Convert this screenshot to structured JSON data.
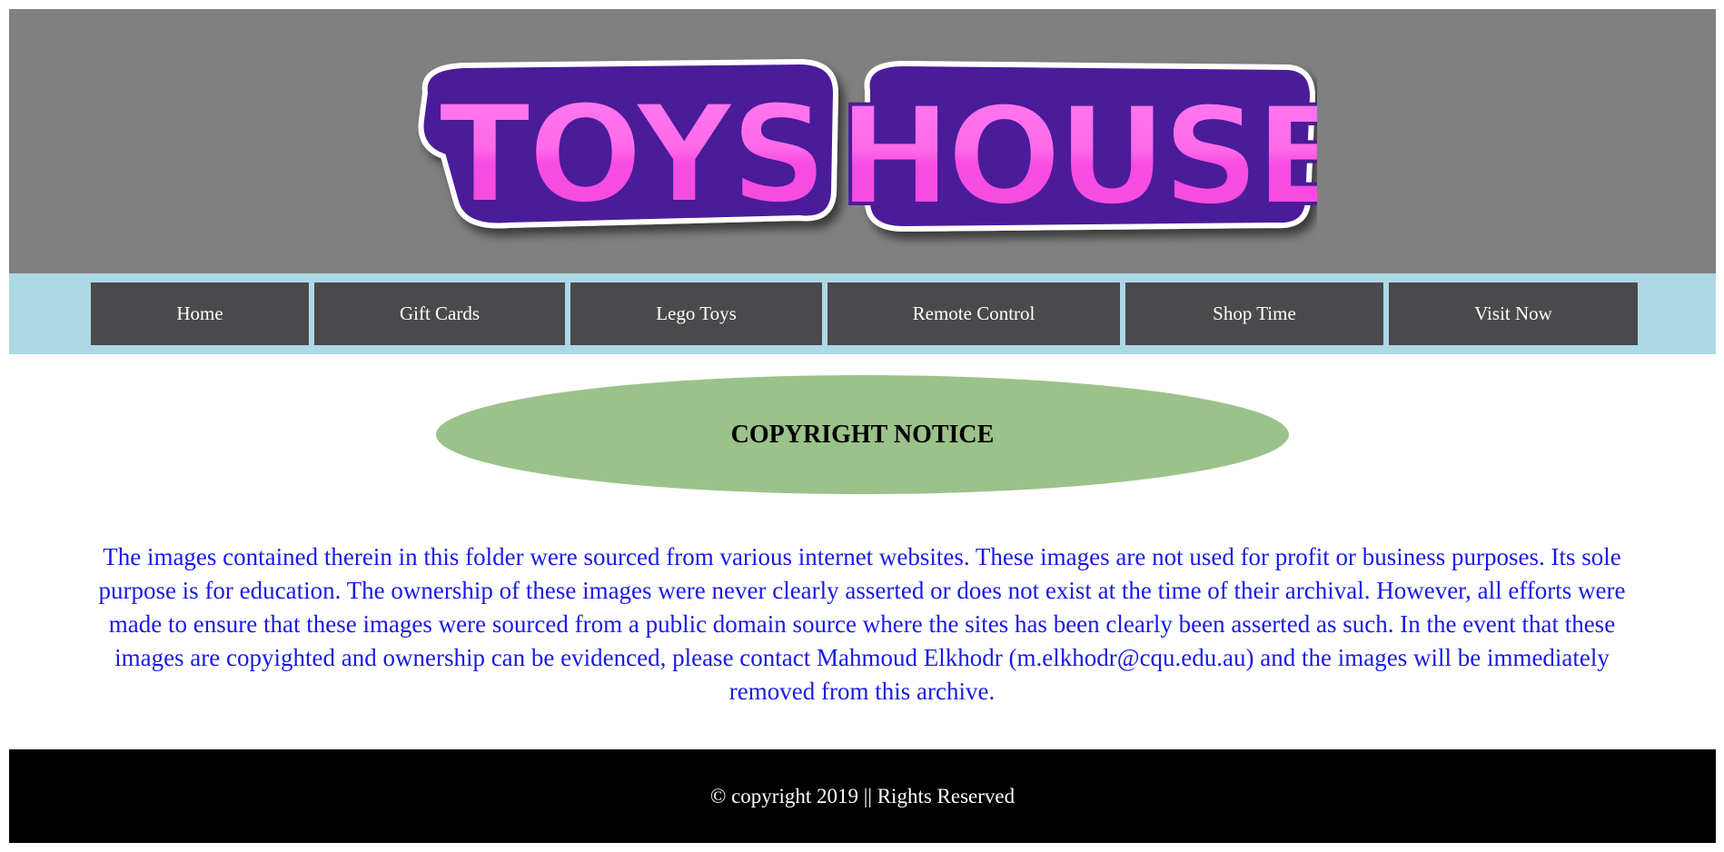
{
  "header": {
    "logo_text": "TOYS HOUSE",
    "background": "#808080"
  },
  "nav": {
    "background": "#add8e6",
    "button_color": "#4a494b",
    "items": [
      {
        "label": "Home"
      },
      {
        "label": "Gift Cards"
      },
      {
        "label": "Lego Toys"
      },
      {
        "label": "Remote Control"
      },
      {
        "label": "Shop Time"
      },
      {
        "label": "Visit Now"
      }
    ]
  },
  "notice": {
    "title": "COPYRIGHT NOTICE",
    "ellipse_color": "#9bc28a",
    "body": "The images contained therein in this folder were sourced from various internet websites. These images are not used for profit or business purposes. Its sole purpose is for education. The ownership of these images were never clearly asserted or does not exist at the time of their archival. However, all efforts were made to ensure that these images were sourced from a public domain source where the sites has been clearly been asserted as such. In the event that these images are copyighted and ownership can be evidenced, please contact Mahmoud Elkhodr (m.elkhodr@cqu.edu.au) and the images will be immediately removed from this archive.",
    "body_color": "#1a1ae6"
  },
  "footer": {
    "text": "© copyright 2019 || Rights Reserved"
  }
}
